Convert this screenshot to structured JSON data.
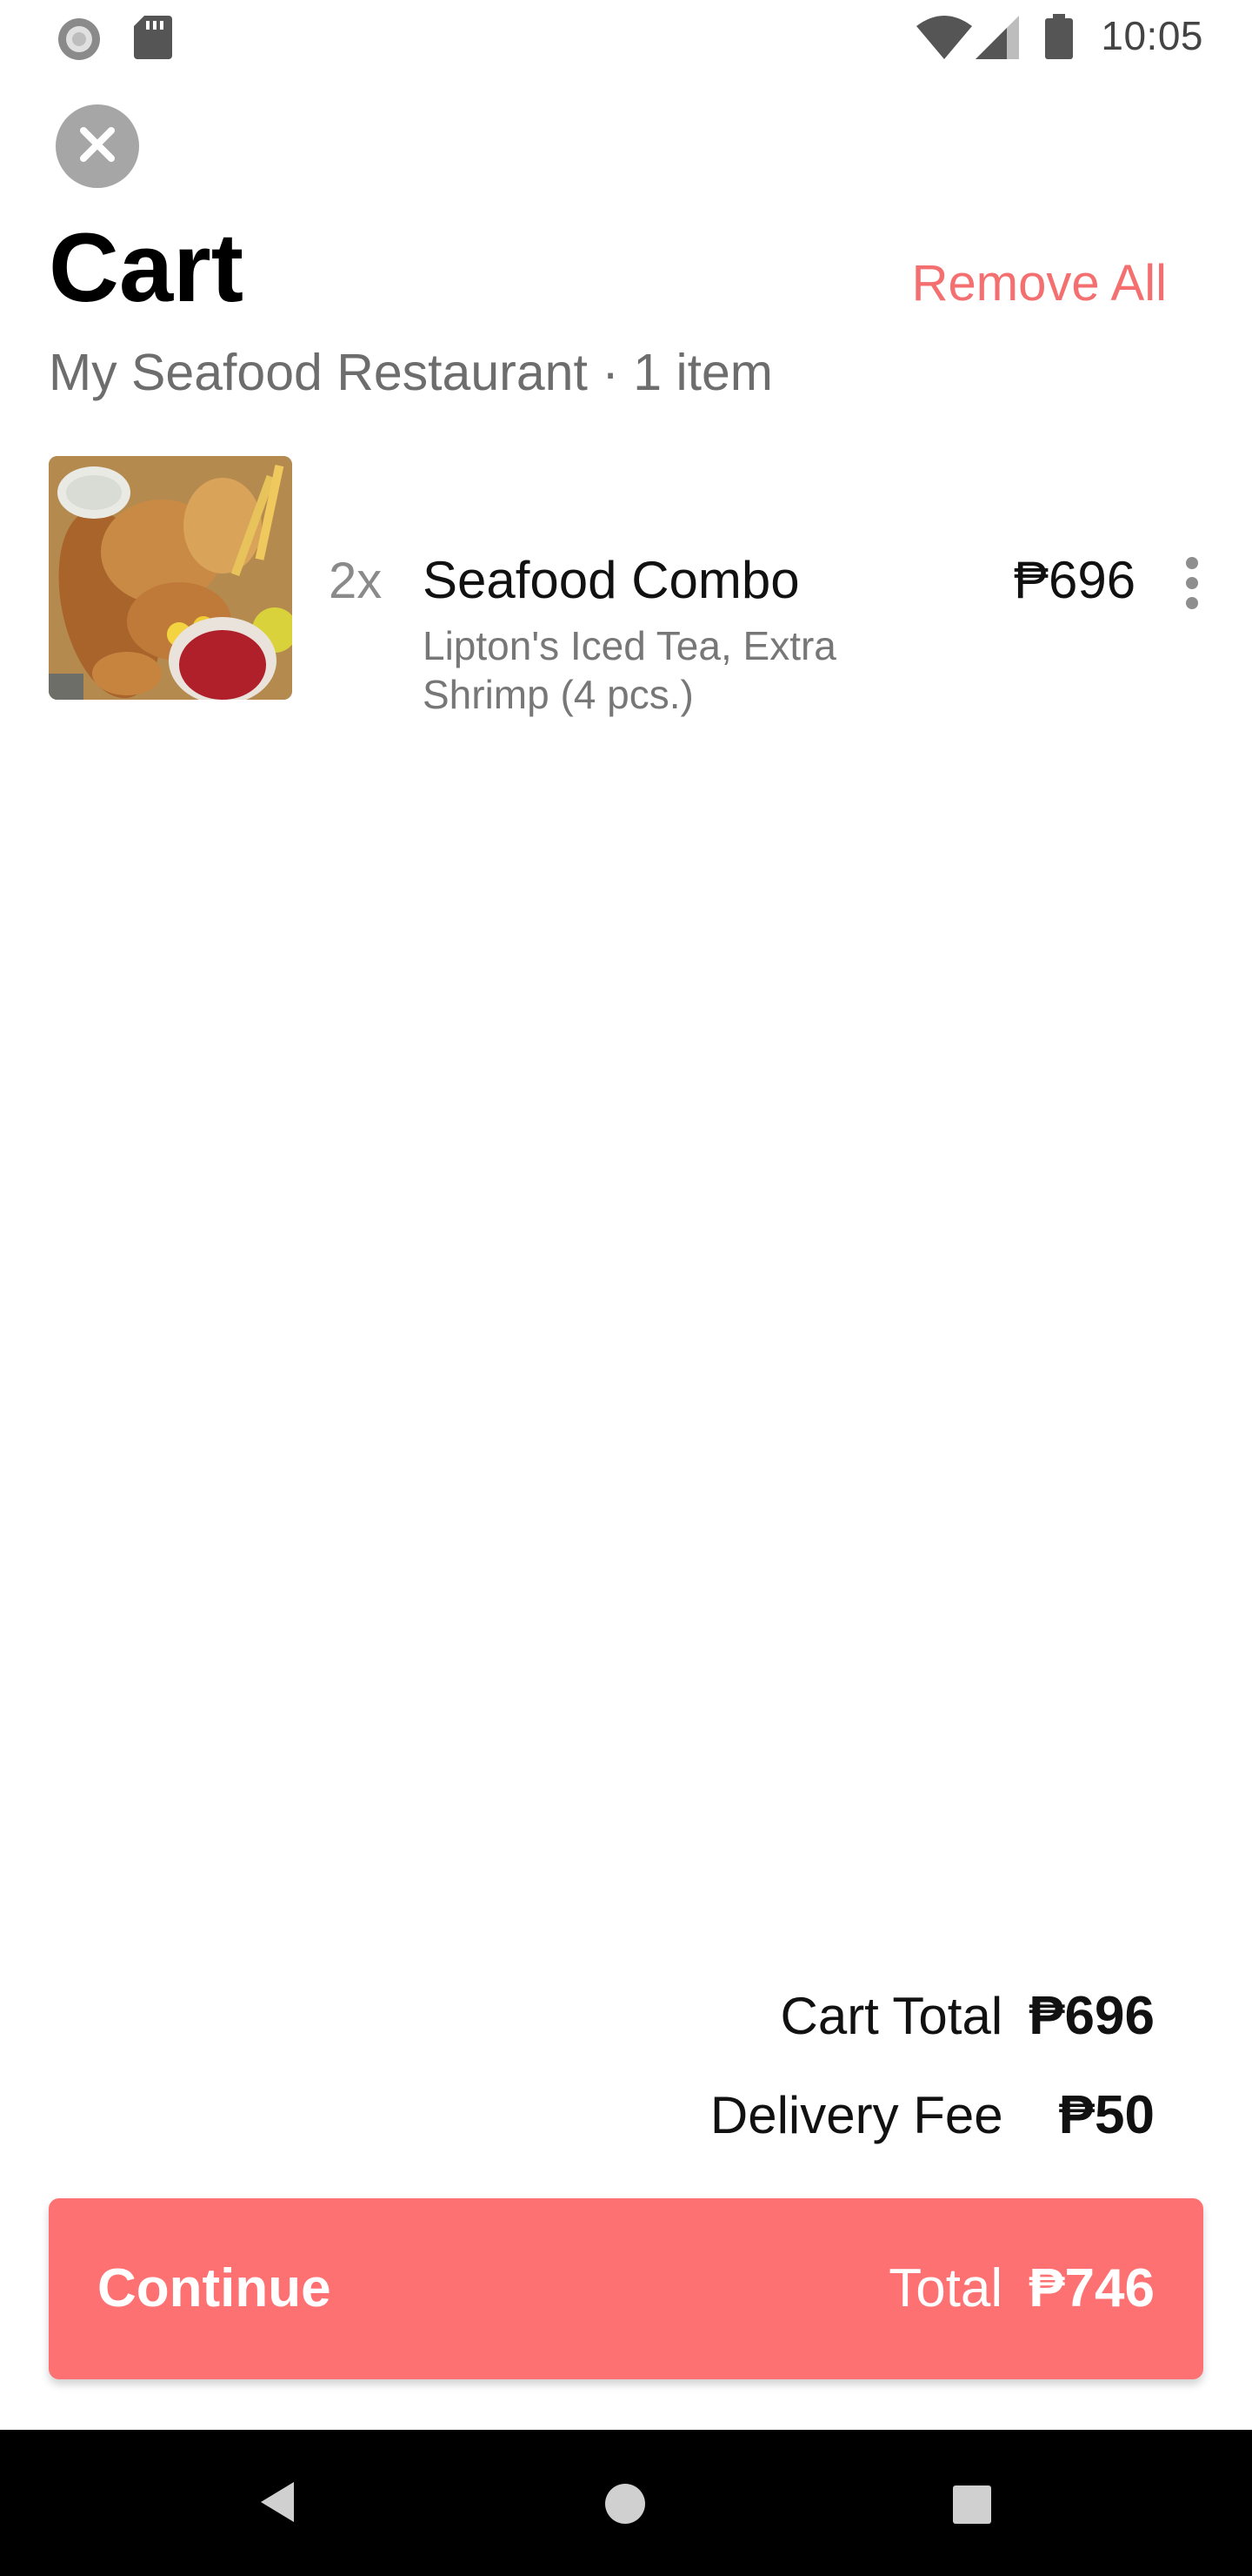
{
  "status_bar": {
    "time": "10:05",
    "icons": [
      "sync-icon",
      "sd-card-icon",
      "wifi-icon",
      "cell-signal-icon",
      "battery-icon"
    ]
  },
  "header": {
    "title": "Cart",
    "remove_all_label": "Remove All",
    "subtitle": "My Seafood Restaurant · 1 item",
    "close_icon": "close-icon"
  },
  "cart": {
    "items": [
      {
        "quantity": "2x",
        "name": "Seafood Combo",
        "options": "Lipton's Iced Tea, Extra Shrimp (4 pcs.)",
        "price": "₱696",
        "image": "seafood-combo-photo"
      }
    ]
  },
  "summary": {
    "cart_total_label": "Cart Total",
    "cart_total_value": "₱696",
    "delivery_fee_label": "Delivery Fee",
    "delivery_fee_value": "₱50"
  },
  "continue_button": {
    "label": "Continue",
    "total_label": "Total",
    "total_value": "₱746"
  },
  "nav_bar": {
    "icons": [
      "back-icon",
      "home-icon",
      "recents-icon"
    ]
  },
  "colors": {
    "accent": "#fe7172",
    "remove_all": "#f46f70",
    "close_button": "#a6a6a6",
    "nav_bar": "#000000"
  }
}
